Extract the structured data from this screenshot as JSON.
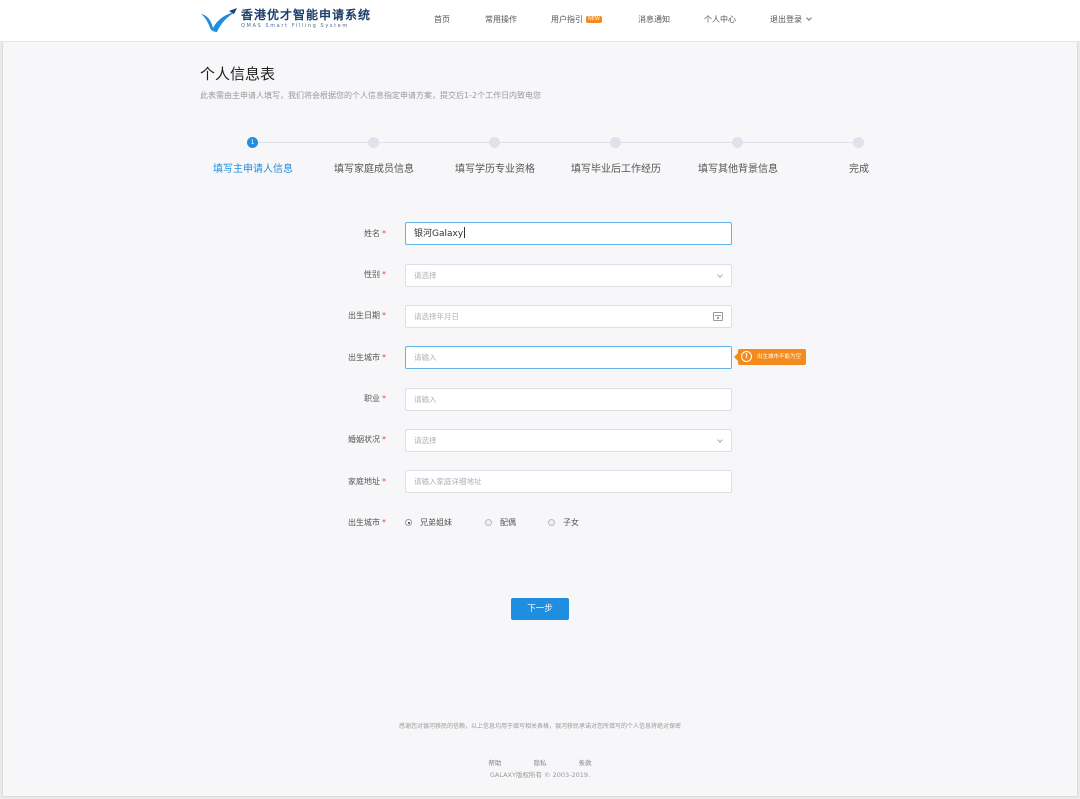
{
  "header": {
    "brand_title": "香港优才智能申请系统",
    "brand_subtitle": "QMAS Smart Filling System",
    "nav": [
      {
        "label": "首页"
      },
      {
        "label": "常用操作"
      },
      {
        "label": "用户指引",
        "badge": "NEW"
      },
      {
        "label": "消息通知"
      },
      {
        "label": "个人中心"
      },
      {
        "label": "退出登录"
      }
    ]
  },
  "page": {
    "title": "个人信息表",
    "subtitle": "此表需由主申请人填写，我们将会根据您的个人信息指定申请方案，提交后1-2个工作日内致电您"
  },
  "steps": [
    {
      "num": "1",
      "label": "填写主申请人信息",
      "active": true
    },
    {
      "num": "2",
      "label": "填写家庭成员信息"
    },
    {
      "num": "3",
      "label": "填写学历专业资格"
    },
    {
      "num": "4",
      "label": "填写毕业后工作经历"
    },
    {
      "num": "5",
      "label": "填写其他背景信息"
    },
    {
      "num": "6",
      "label": "完成"
    }
  ],
  "form": {
    "required_mark": "*",
    "name": {
      "label": "姓名",
      "value": "银河Galaxy"
    },
    "gender": {
      "label": "性别",
      "placeholder": "请选择"
    },
    "birth_date": {
      "label": "出生日期",
      "placeholder": "请选择年月日"
    },
    "birth_city": {
      "label": "出生城市",
      "placeholder": "请输入",
      "error": "出生城市不能为空"
    },
    "occupation": {
      "label": "职业",
      "placeholder": "请输入"
    },
    "marital_status": {
      "label": "婚姻状况",
      "placeholder": "请选择"
    },
    "home_address": {
      "label": "家庭地址",
      "placeholder": "请输入家庭详细地址"
    },
    "relation": {
      "label": "出生城市",
      "options": [
        "兄弟姐妹",
        "配偶",
        "子女"
      ],
      "selected_index": 0
    }
  },
  "next_button": "下一步",
  "footer": {
    "note": "感谢您对银河移民的信赖，以上信息均用于填写相关表格，银河移民承诺对您所填写的个人信息将绝对保密",
    "links": [
      "帮助",
      "隐私",
      "条款"
    ],
    "copyright": "GALAXY版权所有 © 2003-2019."
  },
  "colors": {
    "accent": "#1f8ee0",
    "warning": "#f38a1e",
    "required": "#e04b4b"
  }
}
